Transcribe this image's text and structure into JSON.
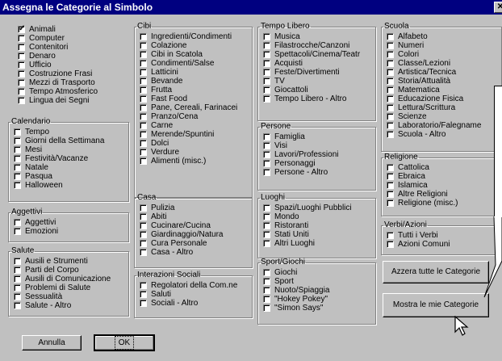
{
  "window": {
    "title": "Assegna le Categorie al Simbolo",
    "close_glyph": "✕"
  },
  "groups": {
    "col1_main": {
      "legend": "",
      "items": [
        {
          "label": "Animali",
          "checked": true
        },
        {
          "label": "Computer",
          "checked": false
        },
        {
          "label": "Contenitori",
          "checked": false
        },
        {
          "label": "Denaro",
          "checked": false
        },
        {
          "label": "Ufficio",
          "checked": false
        },
        {
          "label": "Costruzione Frasi",
          "checked": false
        },
        {
          "label": "Mezzi di Trasporto",
          "checked": false
        },
        {
          "label": "Tempo Atmosferico",
          "checked": false
        },
        {
          "label": "Lingua dei Segni",
          "checked": false
        }
      ]
    },
    "calendario": {
      "legend": "Calendario",
      "items": [
        {
          "label": "Tempo",
          "checked": false
        },
        {
          "label": "Giorni della Settimana",
          "checked": false
        },
        {
          "label": "Mesi",
          "checked": false
        },
        {
          "label": "Festività/Vacanze",
          "checked": false
        },
        {
          "label": "Natale",
          "checked": false
        },
        {
          "label": "Pasqua",
          "checked": false
        },
        {
          "label": "Halloween",
          "checked": false
        }
      ]
    },
    "aggettivi": {
      "legend": "Aggettivi",
      "items": [
        {
          "label": "Aggettivi",
          "checked": false
        },
        {
          "label": "Emozioni",
          "checked": false
        }
      ]
    },
    "salute": {
      "legend": "Salute",
      "items": [
        {
          "label": "Ausili e Strumenti",
          "checked": false
        },
        {
          "label": "Parti del Corpo",
          "checked": false
        },
        {
          "label": "Ausili di Comunicazione",
          "checked": false
        },
        {
          "label": "Problemi di Salute",
          "checked": false
        },
        {
          "label": "Sessualità",
          "checked": false
        },
        {
          "label": "Salute - Altro",
          "checked": false
        }
      ]
    },
    "cibi": {
      "legend": "Cibi",
      "items": [
        {
          "label": "Ingredienti/Condimenti",
          "checked": false
        },
        {
          "label": "Colazione",
          "checked": false
        },
        {
          "label": "Cibi in Scatola",
          "checked": false
        },
        {
          "label": "Condimenti/Salse",
          "checked": false
        },
        {
          "label": "Latticini",
          "checked": false
        },
        {
          "label": "Bevande",
          "checked": false
        },
        {
          "label": "Frutta",
          "checked": false
        },
        {
          "label": "Fast Food",
          "checked": false
        },
        {
          "label": "Pane, Cereali, Farinacei",
          "checked": false
        },
        {
          "label": "Pranzo/Cena",
          "checked": false
        },
        {
          "label": "Carne",
          "checked": false
        },
        {
          "label": "Merende/Spuntini",
          "checked": false
        },
        {
          "label": "Dolci",
          "checked": false
        },
        {
          "label": "Verdure",
          "checked": false
        },
        {
          "label": "Alimenti (misc.)",
          "checked": false
        }
      ]
    },
    "casa": {
      "legend": "Casa",
      "items": [
        {
          "label": "Pulizia",
          "checked": false
        },
        {
          "label": "Abiti",
          "checked": false
        },
        {
          "label": "Cucinare/Cucina",
          "checked": false
        },
        {
          "label": "Giardinaggio/Natura",
          "checked": false
        },
        {
          "label": "Cura Personale",
          "checked": false
        },
        {
          "label": "Casa - Altro",
          "checked": false
        }
      ]
    },
    "interazioni": {
      "legend": "Interazioni Sociali",
      "items": [
        {
          "label": "Regolatori della Com.ne",
          "checked": false
        },
        {
          "label": "Saluti",
          "checked": false
        },
        {
          "label": "Sociali - Altro",
          "checked": false
        }
      ]
    },
    "tempo_libero": {
      "legend": "Tempo Libero",
      "items": [
        {
          "label": "Musica",
          "checked": false
        },
        {
          "label": "Filastrocche/Canzoni",
          "checked": false
        },
        {
          "label": "Spettacoli/Cinema/Teatr",
          "checked": false
        },
        {
          "label": "Acquisti",
          "checked": false
        },
        {
          "label": "Feste/Divertimenti",
          "checked": false
        },
        {
          "label": "TV",
          "checked": false
        },
        {
          "label": "Giocattoli",
          "checked": false
        },
        {
          "label": "Tempo Libero - Altro",
          "checked": false
        }
      ]
    },
    "persone": {
      "legend": "Persone",
      "items": [
        {
          "label": "Famiglia",
          "checked": false
        },
        {
          "label": "Visi",
          "checked": false
        },
        {
          "label": "Lavori/Professioni",
          "checked": false
        },
        {
          "label": "Personaggi",
          "checked": false
        },
        {
          "label": "Persone - Altro",
          "checked": false
        }
      ]
    },
    "luoghi": {
      "legend": "Luoghi",
      "items": [
        {
          "label": "Spazi/Luoghi Pubblici",
          "checked": false
        },
        {
          "label": "Mondo",
          "checked": false
        },
        {
          "label": "Ristoranti",
          "checked": false
        },
        {
          "label": "Stati Uniti",
          "checked": false
        },
        {
          "label": "Altri Luoghi",
          "checked": false
        }
      ]
    },
    "sport": {
      "legend": "Sport/Giochi",
      "items": [
        {
          "label": "Giochi",
          "checked": false
        },
        {
          "label": "Sport",
          "checked": false
        },
        {
          "label": "Nuoto/Spiaggia",
          "checked": false
        },
        {
          "label": "\"Hokey Pokey\"",
          "checked": false
        },
        {
          "label": "\"Simon Says\"",
          "checked": false
        }
      ]
    },
    "scuola": {
      "legend": "Scuola",
      "items": [
        {
          "label": "Alfabeto",
          "checked": false
        },
        {
          "label": "Numeri",
          "checked": false
        },
        {
          "label": "Colori",
          "checked": false
        },
        {
          "label": "Classe/Lezioni",
          "checked": false
        },
        {
          "label": "Artistica/Tecnica",
          "checked": false
        },
        {
          "label": "Storia/Attualità",
          "checked": false
        },
        {
          "label": "Matematica",
          "checked": false
        },
        {
          "label": "Educazione Fisica",
          "checked": false
        },
        {
          "label": "Lettura/Scrittura",
          "checked": false
        },
        {
          "label": "Scienze",
          "checked": false
        },
        {
          "label": "Laboratorio/Falegname",
          "checked": false
        },
        {
          "label": "Scuola - Altro",
          "checked": false
        }
      ]
    },
    "religione": {
      "legend": "Religione",
      "items": [
        {
          "label": "Cattolica",
          "checked": false
        },
        {
          "label": "Ebraica",
          "checked": false
        },
        {
          "label": "Islamica",
          "checked": false
        },
        {
          "label": "Altre Religioni",
          "checked": false
        },
        {
          "label": "Religione (misc.)",
          "checked": false
        }
      ]
    },
    "verbi": {
      "legend": "Verbi/Azioni",
      "items": [
        {
          "label": "Tutti i Verbi",
          "checked": false
        },
        {
          "label": "Azioni Comuni",
          "checked": false
        }
      ]
    }
  },
  "buttons": {
    "azzera": "Azzera tutte le Categorie",
    "mostra": "Mostra le mie Categorie",
    "annulla": "Annulla",
    "ok": "OK"
  }
}
